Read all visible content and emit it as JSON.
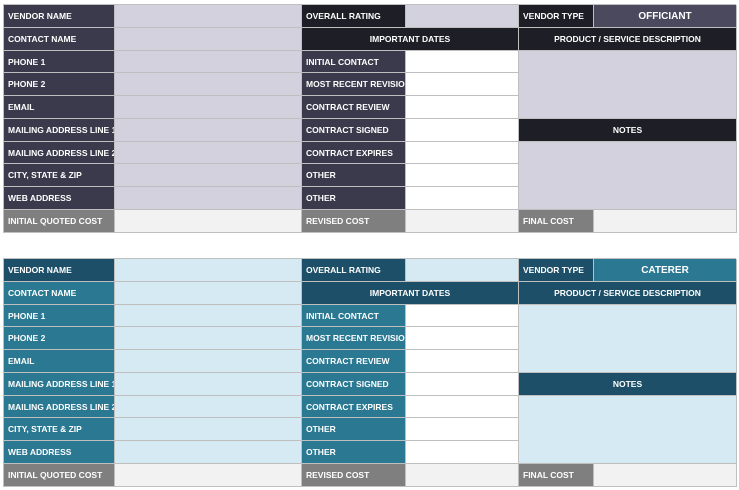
{
  "cards": [
    {
      "vendor_type_value": "OFFICIANT",
      "labels": {
        "vendor_name": "VENDOR NAME",
        "overall_rating": "OVERALL RATING",
        "vendor_type": "VENDOR TYPE",
        "contact_name": "CONTACT NAME",
        "important_dates": "IMPORTANT DATES",
        "product_service_description": "PRODUCT / SERVICE DESCRIPTION",
        "phone1": "PHONE 1",
        "phone2": "PHONE 2",
        "email": "EMAIL",
        "mailing1": "MAILING ADDRESS LINE 1",
        "mailing2": "MAILING ADDRESS LINE 2",
        "city_state_zip": "CITY, STATE & ZIP",
        "web_address": "WEB ADDRESS",
        "initial_quoted_cost": "INITIAL QUOTED COST",
        "initial_contact": "INITIAL CONTACT",
        "most_recent_revision": "MOST RECENT REVISION",
        "contract_review": "CONTRACT REVIEW",
        "contract_signed": "CONTRACT SIGNED",
        "contract_expires": "CONTRACT EXPIRES",
        "other1": "OTHER",
        "other2": "OTHER",
        "revised_cost": "REVISED COST",
        "notes": "NOTES",
        "final_cost": "FINAL COST"
      }
    },
    {
      "vendor_type_value": "CATERER",
      "labels": {
        "vendor_name": "VENDOR NAME",
        "overall_rating": "OVERALL RATING",
        "vendor_type": "VENDOR TYPE",
        "contact_name": "CONTACT NAME",
        "important_dates": "IMPORTANT DATES",
        "product_service_description": "PRODUCT / SERVICE DESCRIPTION",
        "phone1": "PHONE 1",
        "phone2": "PHONE 2",
        "email": "EMAIL",
        "mailing1": "MAILING ADDRESS LINE 1",
        "mailing2": "MAILING ADDRESS LINE 2",
        "city_state_zip": "CITY, STATE & ZIP",
        "web_address": "WEB ADDRESS",
        "initial_quoted_cost": "INITIAL QUOTED COST",
        "initial_contact": "INITIAL CONTACT",
        "most_recent_revision": "MOST RECENT REVISION",
        "contract_review": "CONTRACT REVIEW",
        "contract_signed": "CONTRACT SIGNED",
        "contract_expires": "CONTRACT EXPIRES",
        "other1": "OTHER",
        "other2": "OTHER",
        "revised_cost": "REVISED COST",
        "notes": "NOTES",
        "final_cost": "FINAL COST"
      }
    }
  ],
  "colors": {
    "card1_label": "#3b3a4c",
    "card1_header": "#1e1e26",
    "card1_fill": "#d4d1de",
    "card2_label": "#2a7891",
    "card2_header": "#1d5068",
    "card2_fill": "#d5eaf3",
    "cost_label": "#7f7f7f"
  }
}
